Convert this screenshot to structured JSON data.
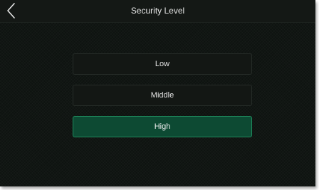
{
  "header": {
    "title": "Security Level",
    "back_icon": "chevron-left-icon"
  },
  "security_options": {
    "items": [
      {
        "label": "Low",
        "selected": false
      },
      {
        "label": "Middle",
        "selected": false
      },
      {
        "label": "High",
        "selected": true
      }
    ]
  },
  "colors": {
    "background": "#0e1310",
    "selected_fill": "#0d4a33",
    "selected_border": "#1f8a5d",
    "text": "#e4e4e4"
  }
}
